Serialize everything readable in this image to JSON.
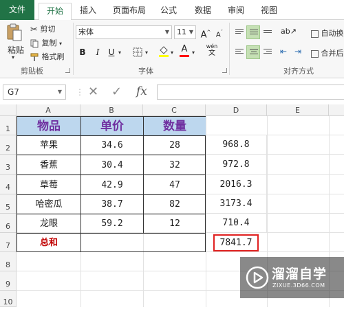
{
  "ribbon_tabs": [
    "文件",
    "开始",
    "插入",
    "页面布局",
    "公式",
    "数据",
    "审阅",
    "视图"
  ],
  "clipboard": {
    "paste": "粘贴",
    "cut": "剪切",
    "copy": "复制",
    "format_painter": "格式刷",
    "group_label": "剪贴板"
  },
  "font": {
    "name": "宋体",
    "size": "11",
    "grow": "A",
    "shrink": "A",
    "bold": "B",
    "italic": "I",
    "underline": "U",
    "fill_color": "#ffff00",
    "font_color": "#ff0000",
    "font_color_glyph": "A",
    "phonetic": "wén",
    "group_label": "字体"
  },
  "alignment": {
    "wrap_text": "自动换",
    "merge_center": "合并后",
    "group_label": "对齐方式"
  },
  "formula_bar": {
    "name_box": "G7",
    "cancel_glyph": "✕",
    "enter_glyph": "✓",
    "fx_glyph": "fx",
    "formula": ""
  },
  "columns": [
    "A",
    "B",
    "C",
    "D",
    "E"
  ],
  "rows": [
    "1",
    "2",
    "3",
    "4",
    "5",
    "6",
    "7",
    "8",
    "9",
    "10"
  ],
  "table": {
    "headers": [
      "物品",
      "单价",
      "数量"
    ],
    "rows": [
      [
        "苹果",
        "34.6",
        "28",
        "968.8"
      ],
      [
        "香蕉",
        "30.4",
        "32",
        "972.8"
      ],
      [
        "草莓",
        "42.9",
        "47",
        "2016.3"
      ],
      [
        "哈密瓜",
        "38.7",
        "82",
        "3173.4"
      ],
      [
        "龙眼",
        "59.2",
        "12",
        "710.4"
      ]
    ],
    "total_label": "总和",
    "total_value": "7841.7",
    "header_bg": "#bdd7ee",
    "header_color": "#7030a0",
    "total_color": "#c00000",
    "highlight_border": "#e0201f"
  },
  "watermark": {
    "name": "溜溜自学",
    "url": "ZIXUE.3D66.COM"
  }
}
